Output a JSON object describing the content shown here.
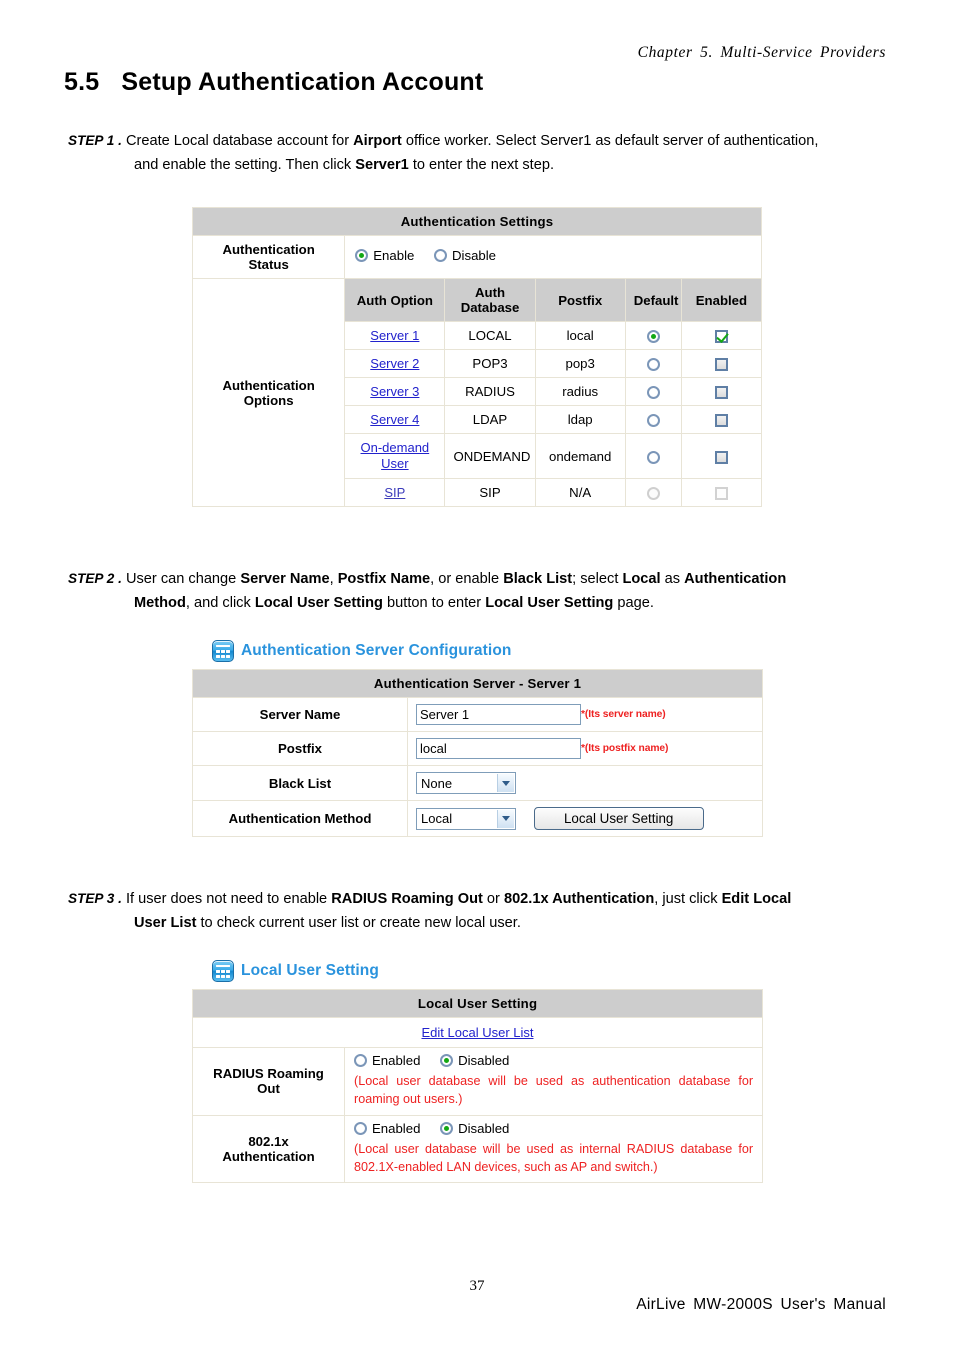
{
  "running_head": "Chapter 5. Multi-Service Providers",
  "section": {
    "number": "5.5",
    "title": "Setup Authentication Account"
  },
  "steps": [
    {
      "tag": "STEP 1 .",
      "line1_a": "Create Local database account for ",
      "line1_b": "Airport",
      "line1_c": " office worker. Select Server1 as default server of authentication,",
      "line2_a": "and enable the setting. Then click ",
      "line2_b": "Server1",
      "line2_c": " to enter the next step."
    },
    {
      "tag": "STEP 2 .",
      "line1_a": "User can change ",
      "line1_b": "Server Name",
      "line1_c": ", ",
      "line1_d": "Postfix Name",
      "line1_e": ", or enable ",
      "line1_f": "Black List",
      "line1_g": "; select ",
      "line1_h": "Local",
      "line1_i": " as ",
      "line1_j": "Authentication",
      "line2_a": "Method",
      "line2_b": ", and click ",
      "line2_c": "Local User Setting",
      "line2_d": " button to enter ",
      "line2_e": "Local User Setting",
      "line2_f": " page."
    },
    {
      "tag": "STEP 3 .",
      "line1_a": "If user does not need to enable ",
      "line1_b": "RADIUS Roaming Out",
      "line1_c": " or ",
      "line1_d": "802.1x Authentication",
      "line1_e": ", just click ",
      "line1_f": "Edit Local",
      "line2_a": "User List",
      "line2_b": " to check current user list or create new local user."
    }
  ],
  "auth_settings": {
    "caption": "Authentication Settings",
    "status_label": "Authentication Status",
    "status_enable": "Enable",
    "status_disable": "Disable",
    "options_label": "Authentication Options",
    "columns": [
      "Auth Option",
      "Auth Database",
      "Postfix",
      "Default",
      "Enabled"
    ],
    "rows": [
      {
        "option": "Server 1",
        "database": "LOCAL",
        "postfix": "local",
        "default": true,
        "enabled": true,
        "disabled": false
      },
      {
        "option": "Server 2",
        "database": "POP3",
        "postfix": "pop3",
        "default": false,
        "enabled": false,
        "disabled": false
      },
      {
        "option": "Server 3",
        "database": "RADIUS",
        "postfix": "radius",
        "default": false,
        "enabled": false,
        "disabled": false
      },
      {
        "option": "Server 4",
        "database": "LDAP",
        "postfix": "ldap",
        "default": false,
        "enabled": false,
        "disabled": false
      },
      {
        "option": "On-demand User",
        "database": "ONDEMAND",
        "postfix": "ondemand",
        "default": false,
        "enabled": false,
        "disabled": false
      },
      {
        "option": "SIP",
        "database": "SIP",
        "postfix": "N/A",
        "default": false,
        "enabled": false,
        "disabled": true
      }
    ]
  },
  "auth_server": {
    "panel_title": "Authentication Server Configuration",
    "panel_icon": "grid-icon",
    "caption": "Authentication Server - Server 1",
    "server_name_label": "Server Name",
    "server_name_value": "Server 1",
    "server_name_hint": "*(Its server name)",
    "postfix_label": "Postfix",
    "postfix_value": "local",
    "postfix_hint": "*(Its postfix name)",
    "black_list_label": "Black List",
    "black_list_value": "None",
    "auth_method_label": "Authentication Method",
    "auth_method_value": "Local",
    "local_user_setting_button": "Local User Setting"
  },
  "local_user": {
    "panel_title": "Local User Setting",
    "panel_icon": "grid-icon",
    "caption": "Local User Setting",
    "edit_link": "Edit Local User List",
    "radius_label": "RADIUS Roaming Out",
    "radius_enabled": "Enabled",
    "radius_disabled": "Disabled",
    "radius_note": "(Local user database will be used as authentication database for roaming out users.)",
    "dot1x_label": "802.1x Authentication",
    "dot1x_enabled": "Enabled",
    "dot1x_disabled": "Disabled",
    "dot1x_note": "(Local user database will be used as internal RADIUS database for 802.1X-enabled LAN devices, such as AP and switch.)"
  },
  "footer": {
    "page_number": "37",
    "manual": "AirLive MW-2000S User's Manual"
  },
  "colors": {
    "link": "#2222cc",
    "panel_title": "#2a93dd",
    "caption_bg": "#cdcdcd",
    "hint_red": "#ee2222",
    "check_green": "#14a814"
  }
}
